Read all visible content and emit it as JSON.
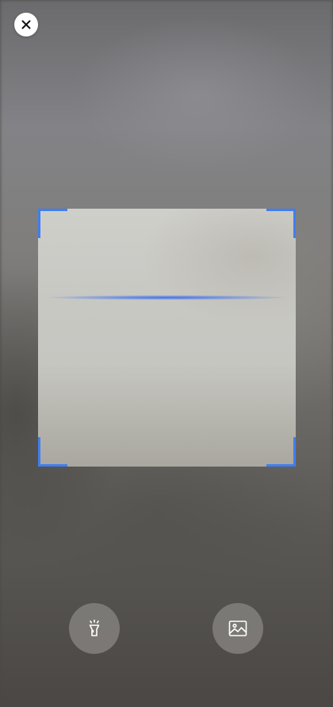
{
  "app": {
    "screen": "qr-scanner"
  },
  "toolbar": {
    "close_icon": "close-icon",
    "flashlight_icon": "flashlight-icon",
    "gallery_icon": "image-gallery-icon"
  },
  "scanner": {
    "frame_color": "#3f7ef2",
    "scan_line_color": "#3468f0"
  }
}
